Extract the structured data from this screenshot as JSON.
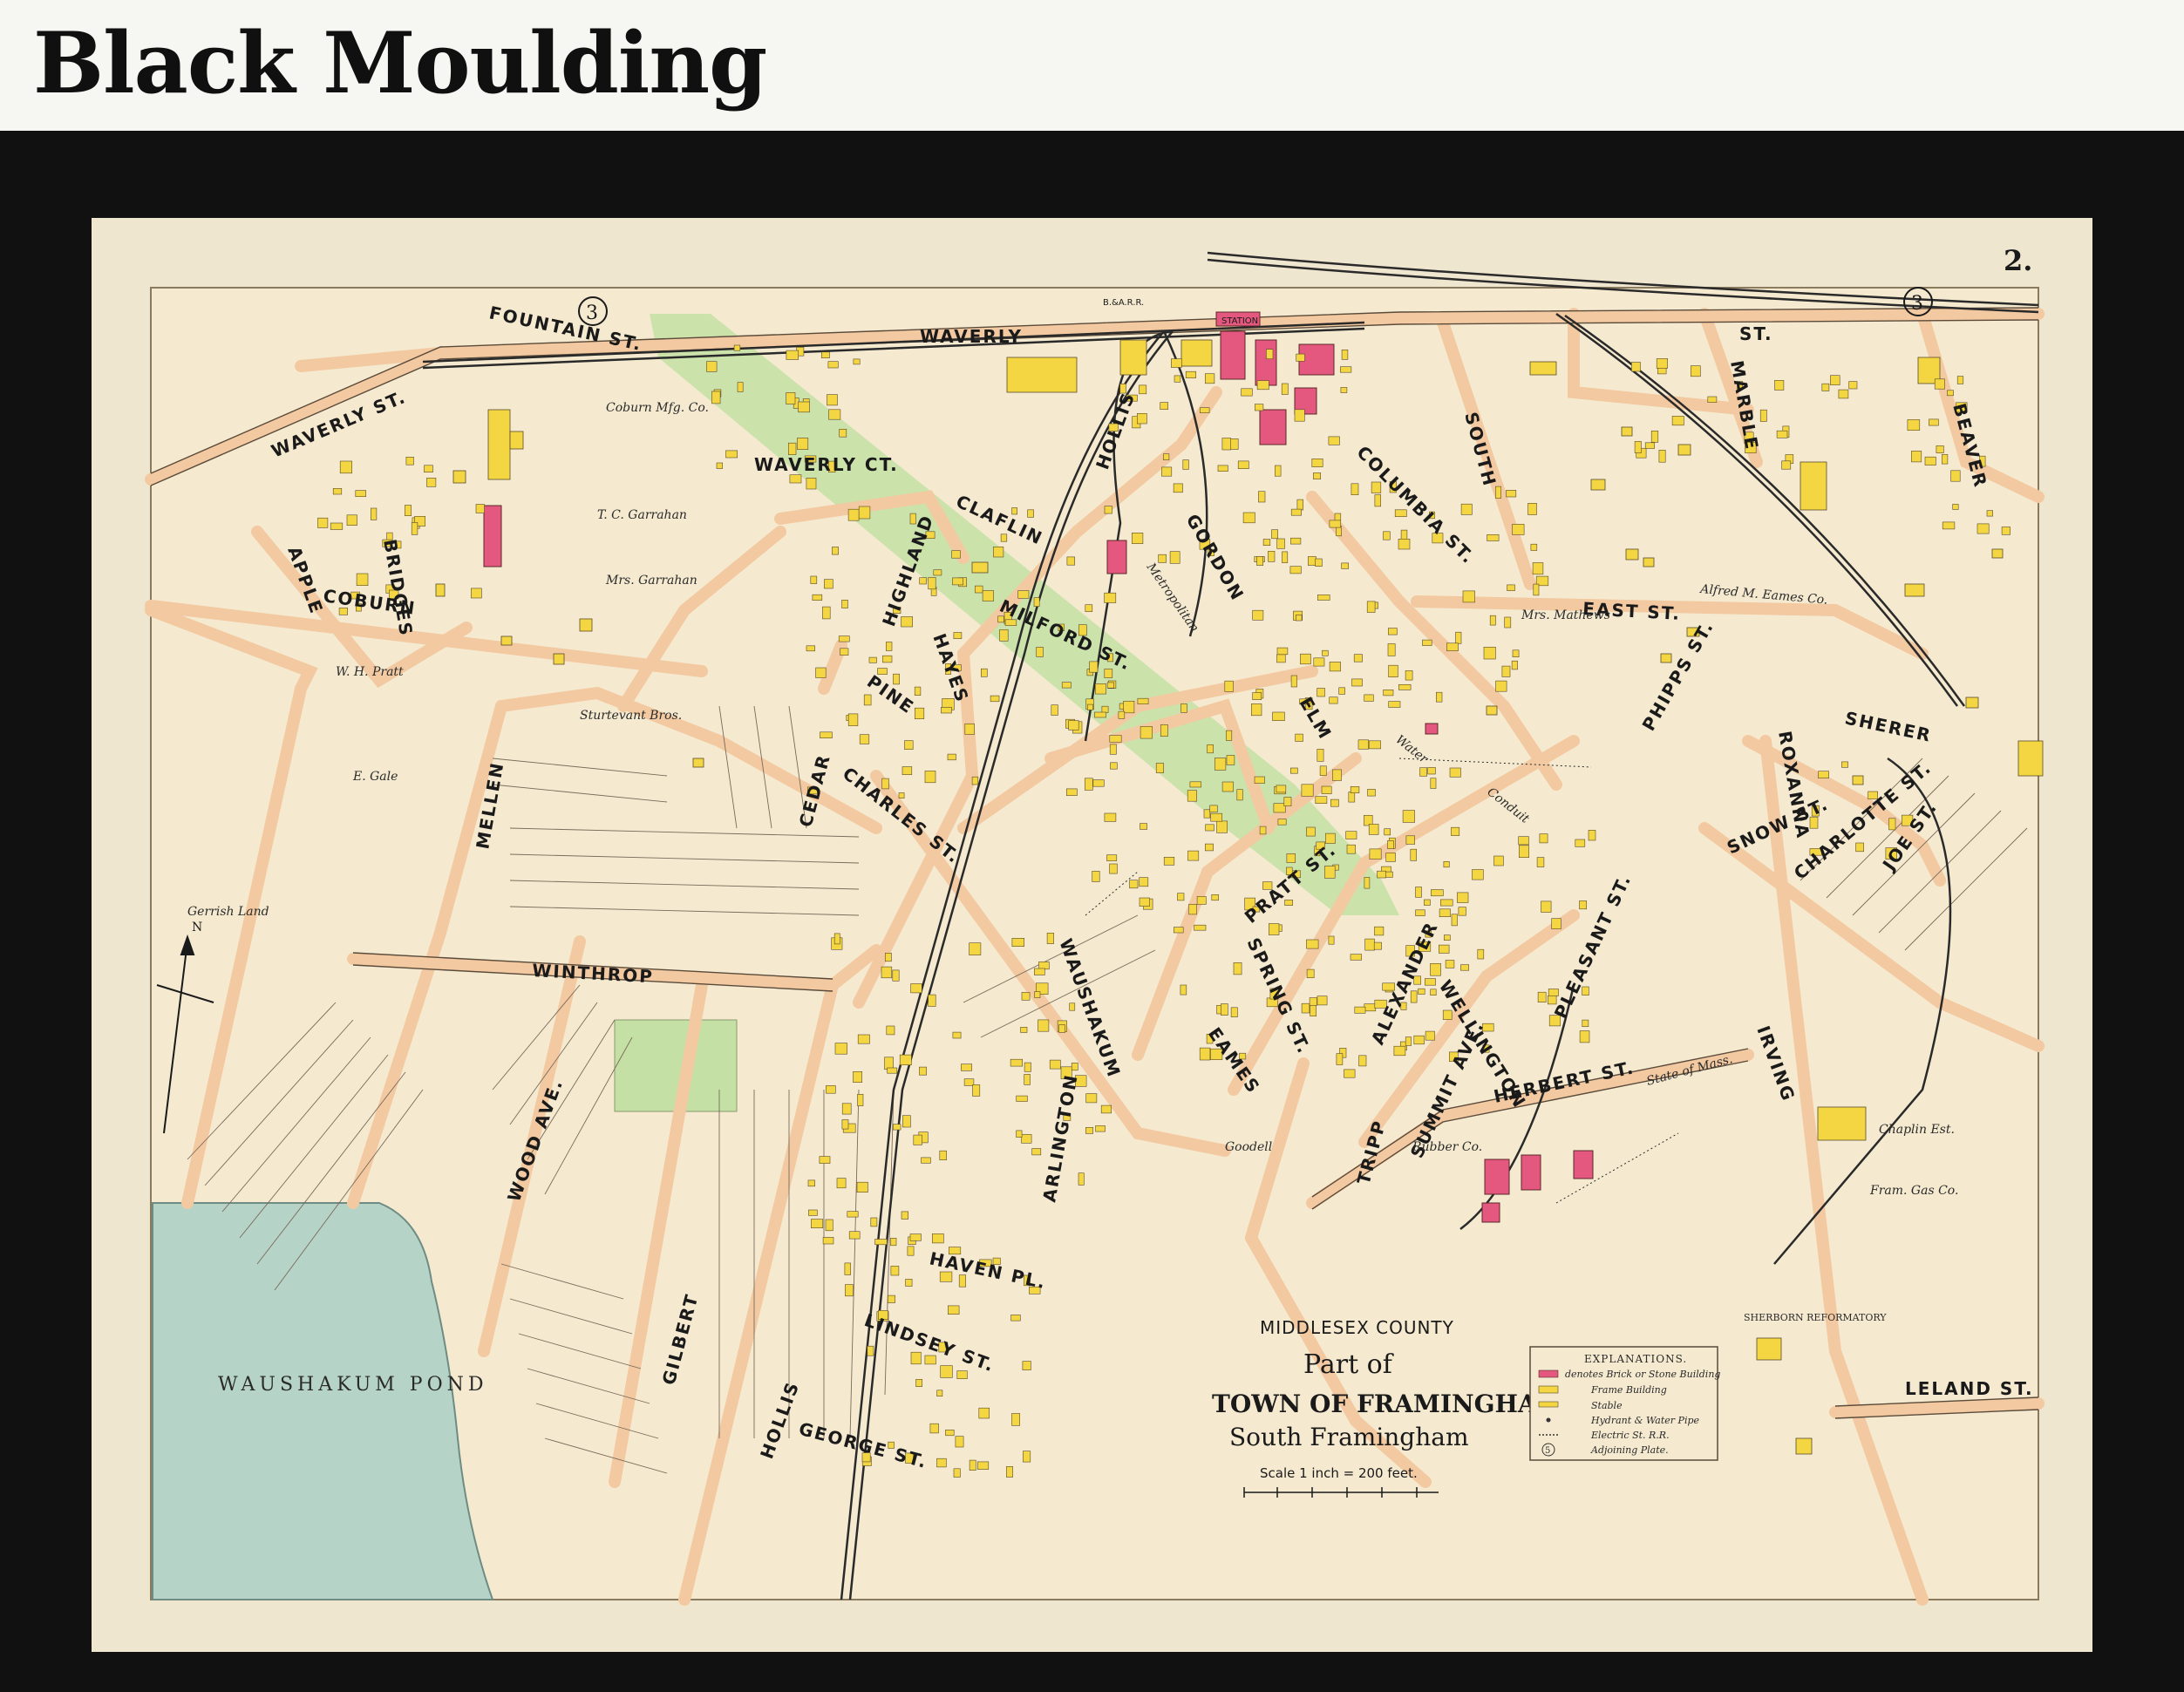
{
  "header": {
    "title": "Black Moulding"
  },
  "map": {
    "plate_number": "2.",
    "adjoining_plate_markers": [
      "3",
      "3"
    ],
    "title_block": {
      "county": "MIDDLESEX COUNTY",
      "part_of": "Part of",
      "town": "TOWN OF FRAMINGHAM",
      "subtitle": "South Framingham",
      "scale": "Scale 1 inch = 200 feet."
    },
    "legend": {
      "title": "EXPLANATIONS.",
      "items": [
        {
          "label": "denotes Brick or Stone Building",
          "swatch": "#e4577e"
        },
        {
          "label": "Frame Building",
          "swatch": "#f3d641"
        },
        {
          "label": "Stable",
          "swatch": "#f3d641"
        },
        {
          "label": "Hydrant & Water Pipe",
          "swatch": "#333333"
        },
        {
          "label": "Electric St. R.R.",
          "swatch": "#333333"
        },
        {
          "label": "Adjoining Plate.",
          "swatch": "#333333"
        }
      ],
      "plate_symbol": "5"
    },
    "pond": {
      "name": "WAUSHAKUM POND"
    },
    "landmarks": {
      "station": "STATION",
      "railroad": "B.&A.R.R."
    },
    "streets": [
      "WAVERLY",
      "ST.",
      "FOUNTAIN ST.",
      "WAVERLY ST.",
      "WAVERLY CT.",
      "COBURN",
      "BRIDGES",
      "APPLE",
      "CLAFLIN",
      "HIGHLAND",
      "PINE",
      "HAYES",
      "MILFORD ST.",
      "CHARLES ST.",
      "CEDAR",
      "MELLEN",
      "WINTHROP",
      "WOOD AVE.",
      "GILBERT",
      "HOLLIS",
      "GEORGE ST.",
      "LINDSEY ST.",
      "HAVEN PL.",
      "ARLINGTON",
      "WAUSHAKUM",
      "EAMES",
      "PRATT ST.",
      "SPRING ST.",
      "ALEXANDER",
      "WELLINGTON",
      "SUMMIT AVE.",
      "PLEASANT ST.",
      "IRVING",
      "HERBERT ST.",
      "TRIPP",
      "GORDON",
      "HOLLIS",
      "COLUMBIA ST.",
      "SOUTH",
      "MARBLE",
      "BEAVER",
      "EAST ST.",
      "PHIPPS ST.",
      "SHERER",
      "ROXANNA",
      "SNOW ST.",
      "CHARLOTTE ST.",
      "JOE ST.",
      "LELAND ST.",
      "ELM"
    ],
    "area_labels": [
      "Coburn Mfg. Co.",
      "T. C. Garrahan",
      "Mrs. Garrahan",
      "W. H. Pratt",
      "Sturtevant Bros.",
      "E. Gale",
      "Gerrish Land",
      "Goodell",
      "State of Mass.",
      "Chaplin Est.",
      "Fram. Gas Co.",
      "Rubber Co.",
      "Alfred M. Eames Co.",
      "Mrs. Mathews",
      "SHERBORN REFORMATORY",
      "Metropolitan",
      "Water",
      "Conduit"
    ]
  },
  "colors": {
    "paper": "#efe6cf",
    "road": "#f2c9a0",
    "pond": "#b5d3c6",
    "park": "#c4e0a4",
    "brick": "#e4577e",
    "frame_building": "#f3d641",
    "moulding": "#111111"
  }
}
